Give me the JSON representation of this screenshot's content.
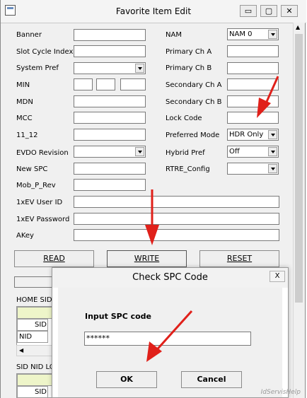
{
  "window": {
    "title": "Favorite Item Edit",
    "minimize_glyph": "▭",
    "restore_glyph": "▢",
    "close_glyph": "✕"
  },
  "left_fields": {
    "banner": "Banner",
    "slot_cycle_index": "Slot Cycle Index",
    "system_pref": "System Pref",
    "min": "MIN",
    "mdn": "MDN",
    "mcc": "MCC",
    "f11_12": "11_12",
    "evdo_revision": "EVDO Revision",
    "new_spc": "New SPC",
    "mob_p_rev": "Mob_P_Rev",
    "ev_user_id": "1xEV User ID",
    "ev_password": "1xEV Password",
    "akey": "AKey"
  },
  "right_fields": {
    "nam": "NAM",
    "nam_value": "NAM 0",
    "primary_ch_a": "Primary Ch A",
    "primary_ch_b": "Primary Ch B",
    "secondary_ch_a": "Secondary Ch A",
    "secondary_ch_b": "Secondary Ch B",
    "lock_code": "Lock Code",
    "preferred_mode": "Preferred Mode",
    "preferred_mode_value": "HDR Only",
    "hybrid_pref": "Hybrid Pref",
    "hybrid_pref_value": "Off",
    "rtre_config": "RTRE_Config"
  },
  "buttons": {
    "read": "READ",
    "write": "WRITE",
    "reset": "RESET"
  },
  "lower": {
    "home_sid": "HOME SID",
    "sid": "SID",
    "nid": "NID",
    "sid_nid_lock": "SID NID LO",
    "sid2": "SID"
  },
  "dialog": {
    "title": "Check SPC Code",
    "close_glyph": "X",
    "label": "Input SPC code",
    "value": "******",
    "ok": "OK",
    "cancel": "Cancel"
  },
  "watermark": "IdServisHelp",
  "colors": {
    "arrow": "#e0201a",
    "grid_header": "#eef5c9"
  }
}
